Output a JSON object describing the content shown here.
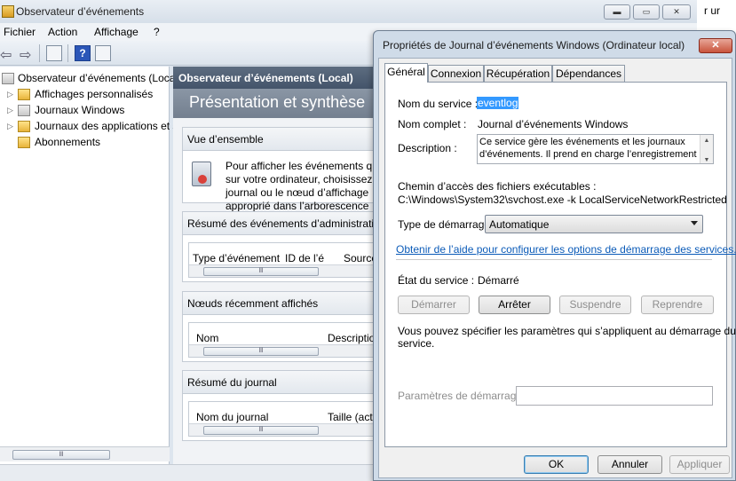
{
  "background_window": {
    "title": "Observateur d’événements",
    "caption_buttons": {
      "minimize": "▬",
      "maximize": "▭",
      "close": "✕"
    },
    "menu": [
      "Fichier",
      "Action",
      "Affichage",
      "?"
    ],
    "toolbar": {
      "back": "⇦",
      "forward": "⇨",
      "help": "?"
    },
    "tree": [
      {
        "label": "Observateur d’événements (Local)",
        "expander": ""
      },
      {
        "label": "Affichages personnalisés",
        "expander": "▷"
      },
      {
        "label": "Journaux Windows",
        "expander": "▷"
      },
      {
        "label": "Journaux des applications et services",
        "expander": "▷"
      },
      {
        "label": "Abonnements",
        "expander": ""
      }
    ],
    "tree_scroll_grip": "lll",
    "pane": {
      "header": "Observateur d’événements (Local)",
      "subtitle": "Présentation et synthèse",
      "overview": {
        "title": "Vue d’ensemble",
        "lines": [
          "Pour afficher les événements qui se sont produits",
          "sur votre ordinateur, choisissez la source",
          "journal ou le nœud d’affichage",
          "approprié dans l’arborescence"
        ]
      },
      "admin_summary": {
        "title": "Résumé des événements d’administration",
        "columns": [
          "Type d’événement",
          "ID de l’é",
          "Source"
        ]
      },
      "recent_nodes": {
        "title": "Nœuds récemment affichés",
        "columns": [
          "Nom",
          "Description"
        ]
      },
      "log_summary": {
        "title": "Résumé du journal",
        "columns": [
          "Nom du journal",
          "Taille (actuelle)"
        ]
      },
      "scroll_grip": "lll"
    },
    "edge_text": "r ur"
  },
  "dialog": {
    "title": "Propriétés de Journal d’événements Windows (Ordinateur local)",
    "close_glyph": "✕",
    "tabs": [
      "Général",
      "Connexion",
      "Récupération",
      "Dépendances"
    ],
    "active_tab": "Général",
    "service_name_label": "Nom du service :",
    "service_name": "eventlog",
    "display_name_label": "Nom complet :",
    "display_name": "Journal d’événements Windows",
    "description_label": "Description :",
    "description_lines": [
      "Ce service gère les événements et les journaux",
      "d’événements. Il prend en charge l’enregistrement"
    ],
    "scroll_up": "▲",
    "scroll_down": "▼",
    "path_label": "Chemin d’accès des fichiers exécutables :",
    "path": "C:\\Windows\\System32\\svchost.exe -k LocalServiceNetworkRestricted",
    "startup_type_label": "Type de démarrage :",
    "startup_type": "Automatique",
    "help_link": "Obtenir de l’aide pour configurer les options de démarrage des services.",
    "status_label": "État du service :",
    "status": "Démarré",
    "buttons": {
      "start": "Démarrer",
      "stop": "Arrêter",
      "pause": "Suspendre",
      "resume": "Reprendre"
    },
    "params_hint_lines": [
      "Vous pouvez spécifier les paramètres qui s’appliquent au démarrage du",
      "service."
    ],
    "params_label": "Paramètres de démarrage :",
    "params_value": "",
    "footer": {
      "ok": "OK",
      "cancel": "Annuler",
      "apply": "Appliquer"
    }
  }
}
